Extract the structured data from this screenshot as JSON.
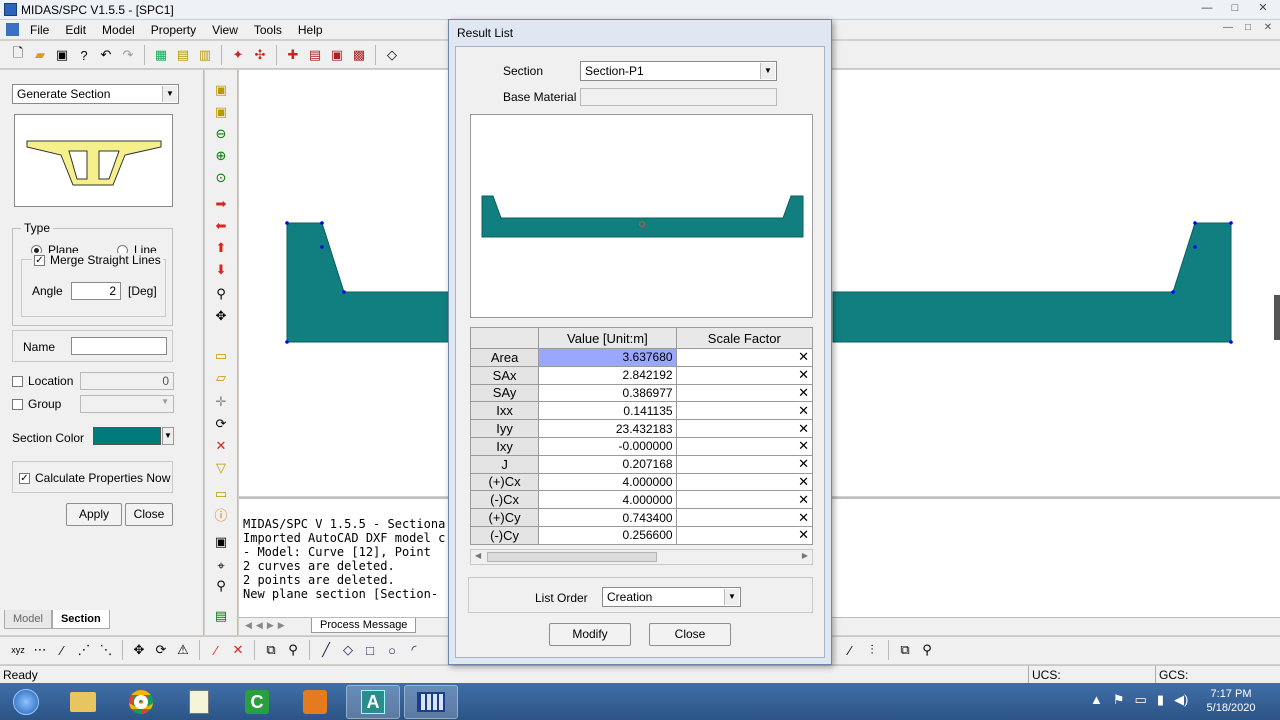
{
  "window": {
    "title": "MIDAS/SPC V1.5.5 - [SPC1]",
    "controls": [
      "—",
      "□",
      "✕"
    ]
  },
  "menu": {
    "items": [
      "File",
      "Edit",
      "Model",
      "Property",
      "View",
      "Tools",
      "Help"
    ]
  },
  "left_panel": {
    "mode_select": "Generate Section",
    "type_label": "Type",
    "plane_label": "Plane",
    "line_label": "Line",
    "merge_label": "Merge Straight Lines",
    "angle_label": "Angle",
    "angle_value": "2",
    "angle_unit": "[Deg]",
    "name_label": "Name",
    "name_value": "",
    "location_label": "Location",
    "location_value": "0",
    "group_label": "Group",
    "section_color_label": "Section Color",
    "section_color": "#007b7b",
    "calc_label": "Calculate Properties Now",
    "apply_label": "Apply",
    "close_label": "Close",
    "tabs": [
      "Model",
      "Section"
    ]
  },
  "messages": {
    "lines": [
      "MIDAS/SPC V 1.5.5 - Sectiona",
      "Imported AutoCAD DXF model c",
      "- Model: Curve [12], Point",
      "2 curves are deleted.",
      "2 points are deleted.",
      "New plane section [Section-"
    ],
    "tab_label": "Process Message"
  },
  "status": {
    "ready": "Ready",
    "ucs": "UCS:",
    "gcs": "GCS:"
  },
  "taskbar": {
    "time": "7:17 PM",
    "date": "5/18/2020"
  },
  "dialog": {
    "title": "Result List",
    "section_label": "Section",
    "section_value": "Section-P1",
    "base_material_label": "Base Material",
    "base_material_value": "",
    "table": {
      "headers": [
        "",
        "Value [Unit:m]",
        "Scale Factor"
      ],
      "rows": [
        {
          "name": "Area",
          "value": "3.637680",
          "scale": "✕"
        },
        {
          "name": "SAx",
          "value": "2.842192",
          "scale": "✕"
        },
        {
          "name": "SAy",
          "value": "0.386977",
          "scale": "✕"
        },
        {
          "name": "Ixx",
          "value": "0.141135",
          "scale": "✕"
        },
        {
          "name": "Iyy",
          "value": "23.432183",
          "scale": "✕"
        },
        {
          "name": "Ixy",
          "value": "-0.000000",
          "scale": "✕"
        },
        {
          "name": "J",
          "value": "0.207168",
          "scale": "✕"
        },
        {
          "name": "(+)Cx",
          "value": "4.000000",
          "scale": "✕"
        },
        {
          "name": "(-)Cx",
          "value": "4.000000",
          "scale": "✕"
        },
        {
          "name": "(+)Cy",
          "value": "0.743400",
          "scale": "✕"
        },
        {
          "name": "(-)Cy",
          "value": "0.256600",
          "scale": "✕"
        }
      ]
    },
    "list_order_label": "List Order",
    "list_order_value": "Creation",
    "modify_label": "Modify",
    "close_label": "Close"
  }
}
